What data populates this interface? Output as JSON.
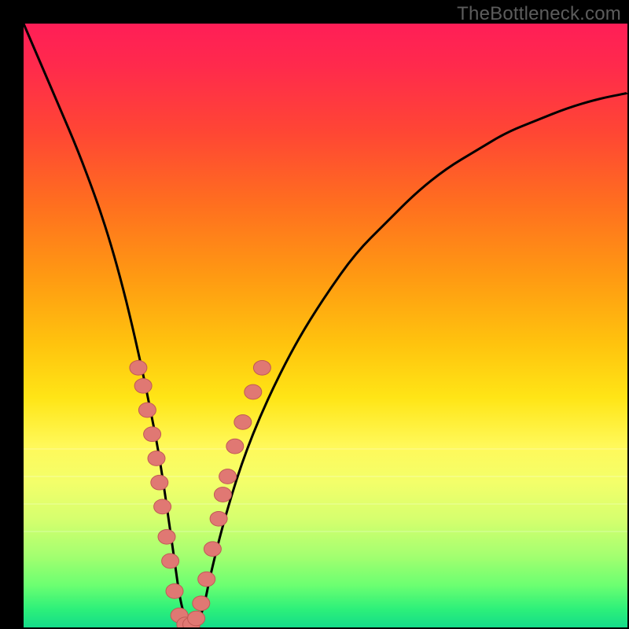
{
  "watermark": "TheBottleneck.com",
  "colors": {
    "dot_fill": "#e07873",
    "dot_stroke": "#c05a55",
    "curve_stroke": "#000000",
    "frame_bg": "#000000"
  },
  "chart_data": {
    "type": "line",
    "title": "",
    "xlabel": "",
    "ylabel": "",
    "xlim": [
      0,
      100
    ],
    "ylim": [
      0,
      100
    ],
    "grid": false,
    "legend": false,
    "series": [
      {
        "name": "bottleneck-curve",
        "x": [
          0,
          3,
          6,
          9,
          12,
          14,
          16,
          18,
          20,
          21,
          22,
          23,
          24,
          25,
          26,
          27,
          28,
          29,
          30,
          31,
          33,
          36,
          40,
          45,
          50,
          55,
          60,
          65,
          70,
          75,
          80,
          85,
          90,
          95,
          100
        ],
        "y": [
          100,
          93,
          86,
          79,
          71,
          65,
          58,
          50,
          41,
          36,
          31,
          25,
          18,
          11,
          4,
          1,
          0,
          1,
          4,
          9,
          17,
          27,
          37,
          47,
          55,
          62,
          67,
          72,
          76,
          79,
          82,
          84,
          86,
          87.5,
          88.5
        ]
      }
    ],
    "markers": {
      "name": "highlighted-points",
      "points": [
        {
          "x": 19.0,
          "y": 43
        },
        {
          "x": 19.8,
          "y": 40
        },
        {
          "x": 20.5,
          "y": 36
        },
        {
          "x": 21.3,
          "y": 32
        },
        {
          "x": 22.0,
          "y": 28
        },
        {
          "x": 22.5,
          "y": 24
        },
        {
          "x": 23.0,
          "y": 20
        },
        {
          "x": 23.7,
          "y": 15
        },
        {
          "x": 24.3,
          "y": 11
        },
        {
          "x": 25.0,
          "y": 6
        },
        {
          "x": 25.8,
          "y": 2
        },
        {
          "x": 26.8,
          "y": 0.5
        },
        {
          "x": 27.8,
          "y": 0.5
        },
        {
          "x": 28.6,
          "y": 1.5
        },
        {
          "x": 29.4,
          "y": 4
        },
        {
          "x": 30.3,
          "y": 8
        },
        {
          "x": 31.3,
          "y": 13
        },
        {
          "x": 32.3,
          "y": 18
        },
        {
          "x": 33.0,
          "y": 22
        },
        {
          "x": 33.8,
          "y": 25
        },
        {
          "x": 35.0,
          "y": 30
        },
        {
          "x": 36.3,
          "y": 34
        },
        {
          "x": 38.0,
          "y": 39
        },
        {
          "x": 39.5,
          "y": 43
        }
      ],
      "radius": 11
    }
  }
}
